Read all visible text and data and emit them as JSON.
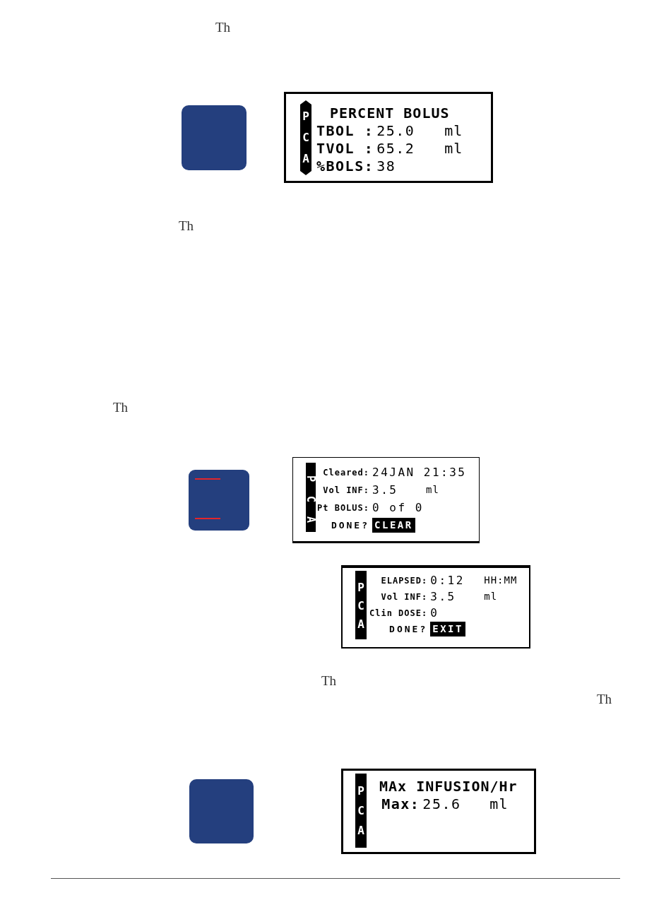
{
  "text_fragments": [
    "Th",
    "Th",
    "Th",
    "Th",
    "Th"
  ],
  "figures": [
    {
      "key": {
        "kind": "plain"
      },
      "screen": {
        "kind": "setting",
        "side_label": "PCA",
        "side_label_rotated": false,
        "scroll_arrows": true,
        "rows": [
          {
            "kind": "title",
            "text": "PERCENT BOLUS"
          },
          {
            "kind": "field",
            "label": "TBOL :",
            "value": "25.0",
            "unit": "ml"
          },
          {
            "kind": "field",
            "label": "TVOL :",
            "value": "65.2",
            "unit": "ml"
          },
          {
            "kind": "field",
            "label": "%BOLS:",
            "value": "38"
          }
        ]
      }
    },
    {
      "key": {
        "kind": "lines"
      },
      "screen": {
        "kind": "summary",
        "side_label": "PCA",
        "side_label_rotated": true,
        "scroll_arrows": false,
        "rows": [
          {
            "kind": "field",
            "label": "Cleared:",
            "value": "24JAN 21:35"
          },
          {
            "kind": "field",
            "label": "Vol INF:",
            "value": "3.5",
            "unit": "ml"
          },
          {
            "kind": "field",
            "label": "Pt BOLUS:",
            "value": "0 of 0"
          },
          {
            "kind": "prompt",
            "label": "DONE?",
            "option": {
              "text": "CLEAR",
              "highlighted": true
            }
          }
        ]
      }
    },
    {
      "screen": {
        "kind": "summary",
        "side_label": "PCA",
        "side_label_rotated": false,
        "scroll_arrows": false,
        "rows": [
          {
            "kind": "field",
            "label": "ELAPSED:",
            "value": "0:12",
            "unit": "HH:MM"
          },
          {
            "kind": "field",
            "label": "Vol INF:",
            "value": "3.5",
            "unit": "ml"
          },
          {
            "kind": "field",
            "label": "Clin DOSE:",
            "value": "0"
          },
          {
            "kind": "prompt",
            "label": "DONE?",
            "option": {
              "text": "EXIT",
              "highlighted": true
            }
          }
        ]
      }
    },
    {
      "key": {
        "kind": "plain"
      },
      "screen": {
        "kind": "setting",
        "side_label": "PCA",
        "side_label_rotated": false,
        "scroll_arrows": false,
        "rows": [
          {
            "kind": "title",
            "text": "MAx INFUSION/Hr"
          },
          {
            "kind": "field",
            "label": "Max:",
            "value": "25.6",
            "unit": "ml"
          }
        ]
      }
    }
  ]
}
